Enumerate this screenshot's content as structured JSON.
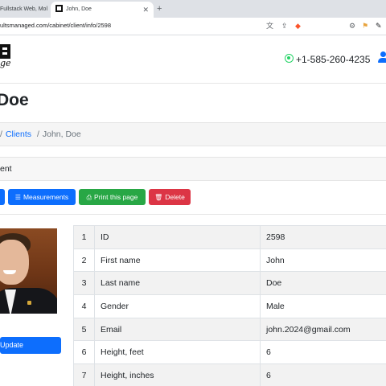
{
  "browser": {
    "tabs": [
      {
        "label": "Fullstack Web, Mol",
        "active": false
      },
      {
        "label": "John, Doe",
        "active": true
      }
    ],
    "new_tab_label": "+",
    "url": "ultsmanaged.com/cabinet/client/info/2598"
  },
  "header": {
    "phone": "+1-585-260-4235"
  },
  "page": {
    "title": "Doe",
    "breadcrumb": {
      "separator": "/",
      "link": "Clients",
      "current": "John, Doe"
    },
    "section_heading": "ent"
  },
  "actions": [
    {
      "label": "",
      "color": "#0d6efd",
      "icon": "pencil-icon"
    },
    {
      "label": "Measurements",
      "color": "#0d6efd",
      "icon": "list-icon"
    },
    {
      "label": "Print this page",
      "color": "#28a745",
      "icon": "printer-icon"
    },
    {
      "label": "Delete",
      "color": "#dc3545",
      "icon": "trash-icon"
    }
  ],
  "photo": {
    "update_label": "Update"
  },
  "info_rows": [
    {
      "n": "1",
      "field": "ID",
      "value": "2598"
    },
    {
      "n": "2",
      "field": "First name",
      "value": "John"
    },
    {
      "n": "3",
      "field": "Last name",
      "value": "Doe"
    },
    {
      "n": "4",
      "field": "Gender",
      "value": "Male"
    },
    {
      "n": "5",
      "field": "Email",
      "value": "john.2024@gmail.com"
    },
    {
      "n": "6",
      "field": "Height, feet",
      "value": "6"
    },
    {
      "n": "7",
      "field": "Height, inches",
      "value": "6"
    }
  ]
}
